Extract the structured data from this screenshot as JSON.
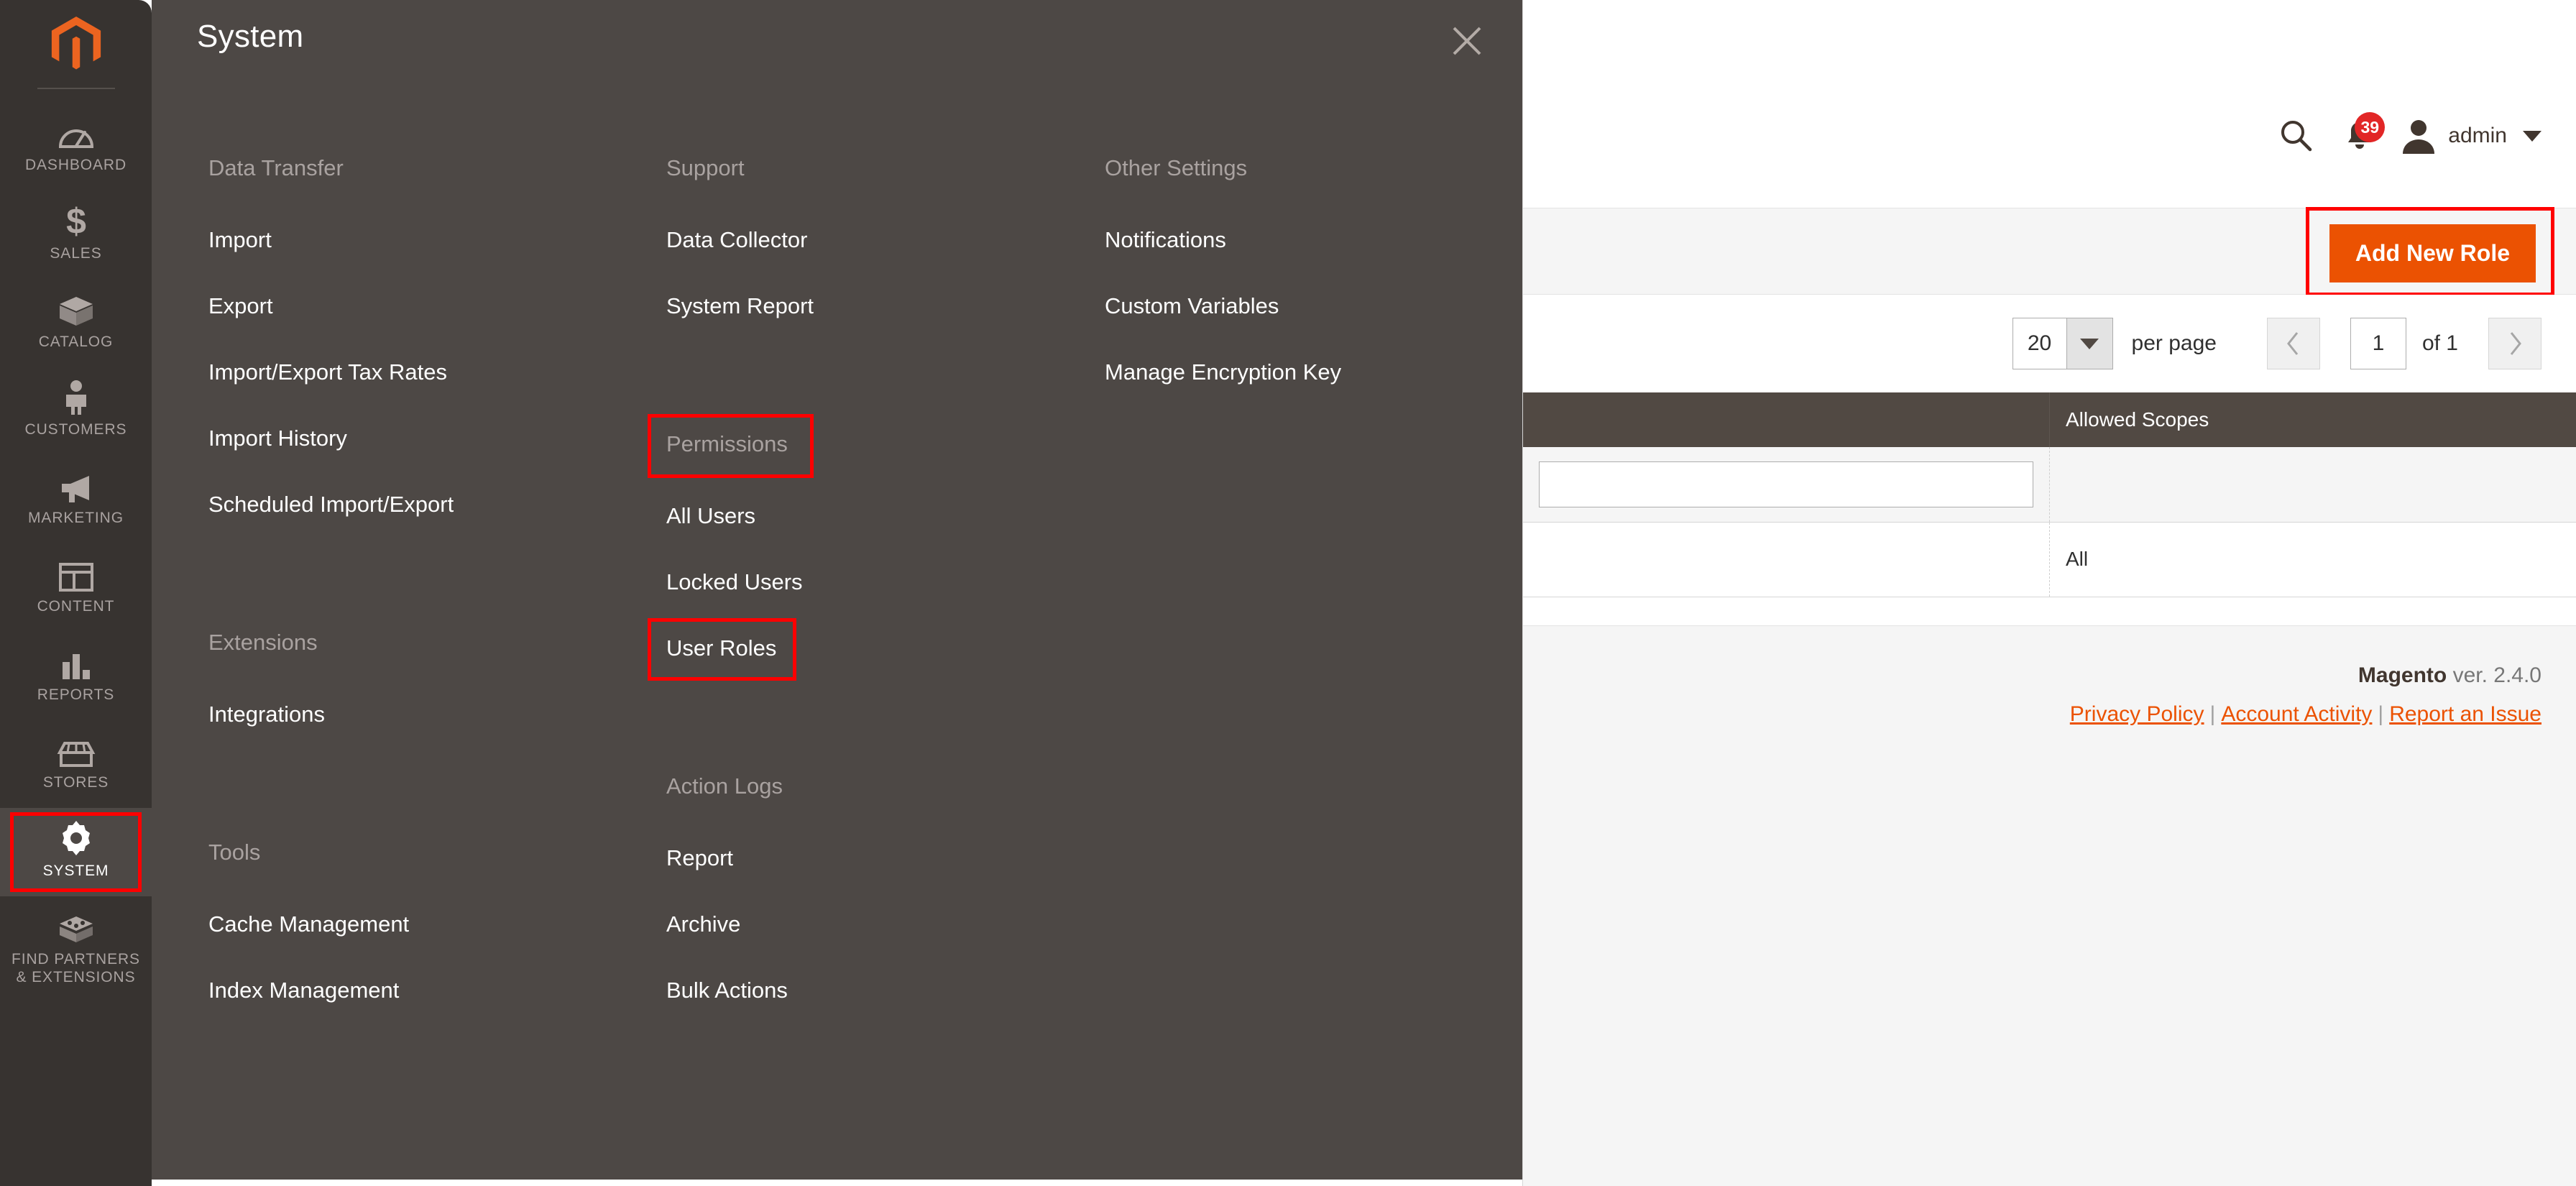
{
  "sidebar": {
    "logo": "magento-logo",
    "items": [
      {
        "label": "Dashboard",
        "icon": "dashboard-icon",
        "active": false,
        "annotated": false
      },
      {
        "label": "Sales",
        "icon": "dollar-icon",
        "active": false,
        "annotated": false
      },
      {
        "label": "Catalog",
        "icon": "box-icon",
        "active": false,
        "annotated": false
      },
      {
        "label": "Customers",
        "icon": "person-icon",
        "active": false,
        "annotated": false
      },
      {
        "label": "Marketing",
        "icon": "megaphone-icon",
        "active": false,
        "annotated": false
      },
      {
        "label": "Content",
        "icon": "layout-icon",
        "active": false,
        "annotated": false
      },
      {
        "label": "Reports",
        "icon": "bar-chart-icon",
        "active": false,
        "annotated": false
      },
      {
        "label": "Stores",
        "icon": "storefront-icon",
        "active": false,
        "annotated": false
      },
      {
        "label": "System",
        "icon": "gear-icon",
        "active": true,
        "annotated": true
      },
      {
        "label": "Find Partners\n& Extensions",
        "icon": "extensions-icon",
        "active": false,
        "annotated": false
      }
    ]
  },
  "menu_panel": {
    "title": "System",
    "close_icon": "close-icon",
    "columns": [
      {
        "groups": [
          {
            "title": "Data Transfer",
            "title_annotated": false,
            "links": [
              {
                "label": "Import",
                "annotated": false
              },
              {
                "label": "Export",
                "annotated": false
              },
              {
                "label": "Import/Export Tax Rates",
                "annotated": false
              },
              {
                "label": "Import History",
                "annotated": false
              },
              {
                "label": "Scheduled Import/Export",
                "annotated": false
              }
            ]
          },
          {
            "title": "Extensions",
            "title_annotated": false,
            "links": [
              {
                "label": "Integrations",
                "annotated": false
              }
            ]
          },
          {
            "title": "Tools",
            "title_annotated": false,
            "links": [
              {
                "label": "Cache Management",
                "annotated": false
              },
              {
                "label": "Index Management",
                "annotated": false
              }
            ]
          }
        ]
      },
      {
        "groups": [
          {
            "title": "Support",
            "title_annotated": false,
            "links": [
              {
                "label": "Data Collector",
                "annotated": false
              },
              {
                "label": "System Report",
                "annotated": false
              }
            ]
          },
          {
            "title": "Permissions",
            "title_annotated": true,
            "links": [
              {
                "label": "All Users",
                "annotated": false
              },
              {
                "label": "Locked Users",
                "annotated": false
              },
              {
                "label": "User Roles",
                "annotated": true
              }
            ]
          },
          {
            "title": "Action Logs",
            "title_annotated": false,
            "links": [
              {
                "label": "Report",
                "annotated": false
              },
              {
                "label": "Archive",
                "annotated": false
              },
              {
                "label": "Bulk Actions",
                "annotated": false
              }
            ]
          }
        ]
      },
      {
        "groups": [
          {
            "title": "Other Settings",
            "title_annotated": false,
            "links": [
              {
                "label": "Notifications",
                "annotated": false
              },
              {
                "label": "Custom Variables",
                "annotated": false
              },
              {
                "label": "Manage Encryption Key",
                "annotated": false
              }
            ]
          }
        ]
      }
    ]
  },
  "admin_header": {
    "search_icon": "search-icon",
    "bell_icon": "bell-icon",
    "notification_count": "39",
    "avatar_icon": "user-avatar-icon",
    "user_name": "admin",
    "caret_icon": "chevron-down-icon"
  },
  "page_actions": {
    "add_new_role_label": "Add New Role",
    "primary_color": "#eb5202",
    "annotation_color": "#ff0000"
  },
  "pagination": {
    "per_page_value": "20",
    "per_page_label": "per page",
    "prev_icon": "chevron-left-icon",
    "next_icon": "chevron-right-icon",
    "current_page": "1",
    "of_label": "of 1"
  },
  "grid": {
    "columns": [
      "",
      "Allowed Scopes"
    ],
    "filter_row": {
      "name_filter_value": "",
      "name_filter_placeholder": ""
    },
    "rows": [
      {
        "cells": [
          "",
          "All"
        ]
      }
    ]
  },
  "footer": {
    "product": "Magento",
    "version": "ver. 2.4.0",
    "links": [
      "Privacy Policy",
      "Account Activity",
      "Report an Issue"
    ],
    "separator": "|"
  }
}
